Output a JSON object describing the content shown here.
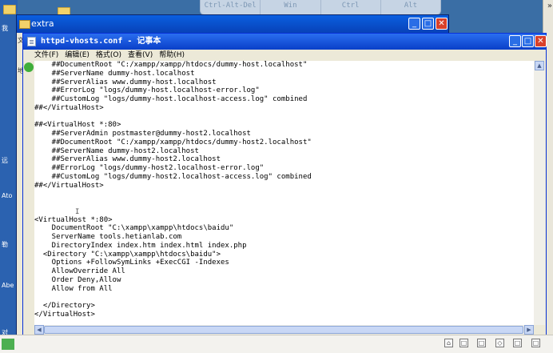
{
  "remote_toolbar": {
    "keys": [
      "Ctrl-Alt-Del",
      "Win",
      "Ctrl",
      "Alt"
    ]
  },
  "explorer": {
    "title": "extra",
    "side_labels": [
      "文",
      "地"
    ]
  },
  "notepad": {
    "title": "httpd-vhosts.conf - 记事本",
    "menu": [
      "文件(F)",
      "编辑(E)",
      "格式(O)",
      "查看(V)",
      "帮助(H)"
    ],
    "lines": [
      "    ##DocumentRoot \"C:/xampp/xampp/htdocs/dummy-host.localhost\"",
      "    ##ServerName dummy-host.localhost",
      "    ##ServerAlias www.dummy-host.localhost",
      "    ##ErrorLog \"logs/dummy-host.localhost-error.log\"",
      "    ##CustomLog \"logs/dummy-host.localhost-access.log\" combined",
      "##</VirtualHost>",
      "",
      "##<VirtualHost *:80>",
      "    ##ServerAdmin postmaster@dummy-host2.localhost",
      "    ##DocumentRoot \"C:/xampp/xampp/htdocs/dummy-host2.localhost\"",
      "    ##ServerName dummy-host2.localhost",
      "    ##ServerAlias www.dummy-host2.localhost",
      "    ##ErrorLog \"logs/dummy-host2.localhost-error.log\"",
      "    ##CustomLog \"logs/dummy-host2.localhost-access.log\" combined",
      "##</VirtualHost>",
      "",
      "",
      "",
      "<VirtualHost *:80>",
      "    DocumentRoot \"C:\\xampp\\xampp\\htdocs\\baidu\"",
      "    ServerName tools.hetianlab.com",
      "    DirectoryIndex index.htm index.html index.php",
      "  <Directory \"C:\\xampp\\xampp\\htdocs\\baidu\">",
      "    Options +FollowSymLinks +ExecCGI -Indexes",
      "    AllowOverride All",
      "    Order Deny,Allow",
      "    Allow from All",
      "",
      "  </Directory>",
      "</VirtualHost>"
    ]
  },
  "desktop_labels": [
    "我",
    "远",
    "Ato",
    "勒",
    "Abe",
    "对"
  ],
  "colors": {
    "title_blue": "#0a3fc8",
    "desktop_blue": "#3a6ea5",
    "close_red": "#d9412b"
  }
}
